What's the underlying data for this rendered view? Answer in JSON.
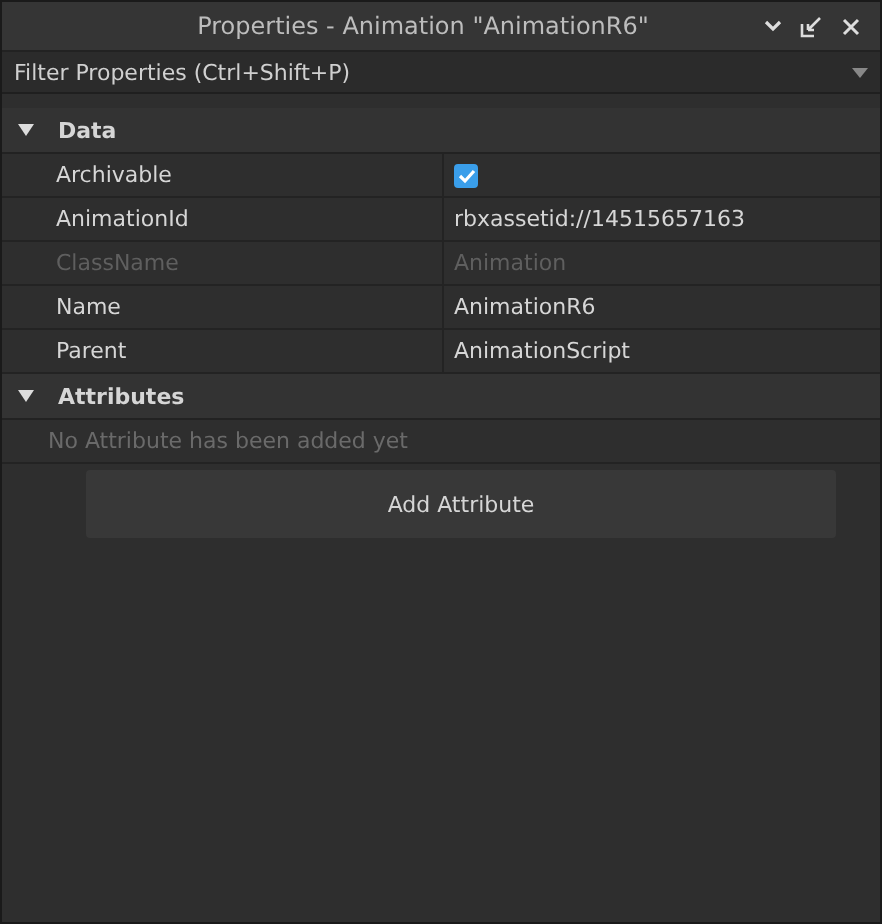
{
  "window": {
    "title": "Properties - Animation \"AnimationR6\""
  },
  "filter": {
    "placeholder": "Filter Properties (Ctrl+Shift+P)"
  },
  "sections": [
    {
      "title": "Data",
      "expanded": true,
      "properties": [
        {
          "name": "Archivable",
          "kind": "checkbox",
          "checked": true,
          "disabled": false
        },
        {
          "name": "AnimationId",
          "kind": "text",
          "value": "rbxassetid://14515657163",
          "disabled": false
        },
        {
          "name": "ClassName",
          "kind": "text",
          "value": "Animation",
          "disabled": true
        },
        {
          "name": "Name",
          "kind": "text",
          "value": "AnimationR6",
          "disabled": false
        },
        {
          "name": "Parent",
          "kind": "text",
          "value": "AnimationScript",
          "disabled": false
        }
      ]
    },
    {
      "title": "Attributes",
      "expanded": true,
      "empty_message": "No Attribute has been added yet",
      "button": "Add Attribute"
    }
  ]
}
